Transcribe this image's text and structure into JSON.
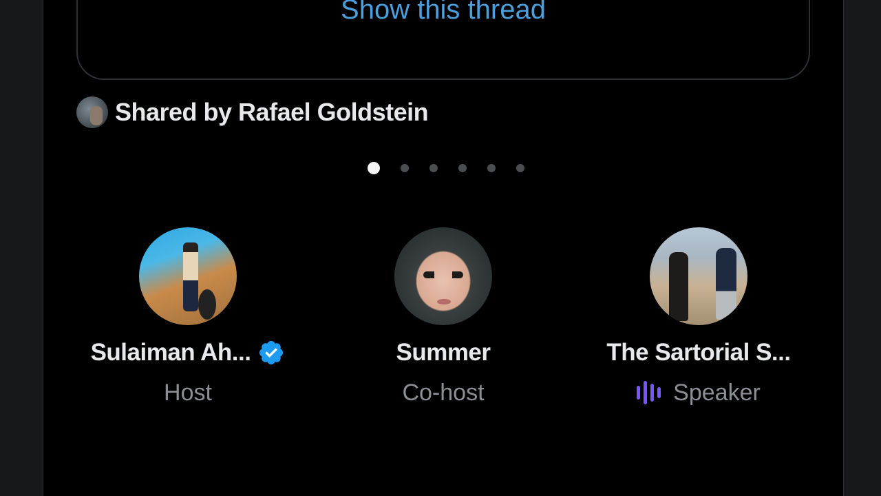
{
  "thread": {
    "show_label": "Show this thread"
  },
  "shared_by": {
    "label": "Shared by Rafael Goldstein"
  },
  "carousel": {
    "total_pages": 6,
    "active_index": 0
  },
  "participants": [
    {
      "name": "Sulaiman Ah...",
      "role": "Host",
      "verified": true,
      "speaking": false
    },
    {
      "name": "Summer",
      "role": "Co-host",
      "verified": false,
      "speaking": false
    },
    {
      "name": "The Sartorial S...",
      "role": "Speaker",
      "verified": false,
      "speaking": true
    }
  ],
  "colors": {
    "link": "#4a9fdc",
    "verified": "#1d9bf0",
    "speaking": "#7856ff",
    "text_primary": "#e7e9ea",
    "text_secondary": "#8b8f94"
  }
}
